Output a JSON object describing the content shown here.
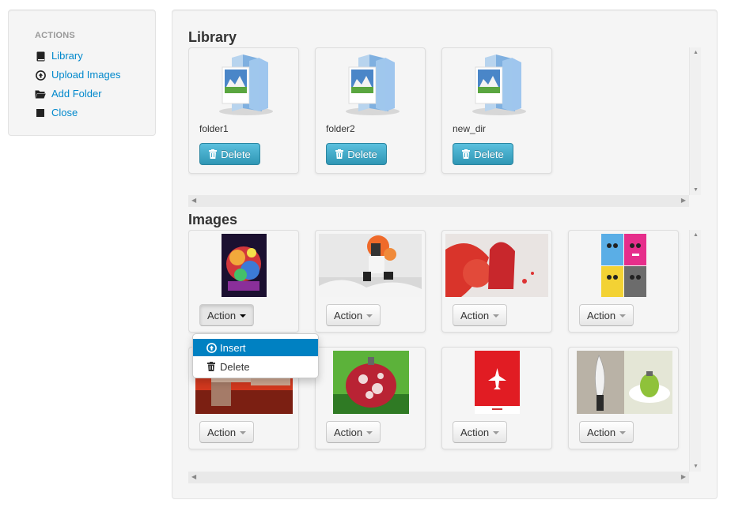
{
  "sidebar": {
    "header": "ACTIONS",
    "items": [
      {
        "label": "Library",
        "icon": "book-icon"
      },
      {
        "label": "Upload Images",
        "icon": "upload-icon"
      },
      {
        "label": "Add Folder",
        "icon": "folder-open-icon"
      },
      {
        "label": "Close",
        "icon": "stop-icon"
      }
    ]
  },
  "library": {
    "title": "Library",
    "folders": [
      {
        "name": "folder1",
        "delete_label": "Delete"
      },
      {
        "name": "folder2",
        "delete_label": "Delete"
      },
      {
        "name": "new_dir",
        "delete_label": "Delete"
      }
    ]
  },
  "images": {
    "title": "Images",
    "action_label": "Action",
    "items": [
      {
        "subject": "colorful portrait painting"
      },
      {
        "subject": "man jumping over splash"
      },
      {
        "subject": "woman with headphones red splash"
      },
      {
        "subject": "four panel pop art faces"
      },
      {
        "subject": "hands reaching red"
      },
      {
        "subject": "strawberry grenade on green"
      },
      {
        "subject": "white plane on red poster"
      },
      {
        "subject": "knife and grenade on plate"
      }
    ]
  },
  "action_menu": {
    "items": [
      {
        "label": "Insert",
        "icon": "upload-icon",
        "active": true
      },
      {
        "label": "Delete",
        "icon": "trash-icon",
        "active": false
      }
    ]
  },
  "colors": {
    "link": "#0088cc",
    "info_button": "#49afcd",
    "dropdown_active": "#0081c2",
    "panel_bg": "#f5f5f5"
  }
}
